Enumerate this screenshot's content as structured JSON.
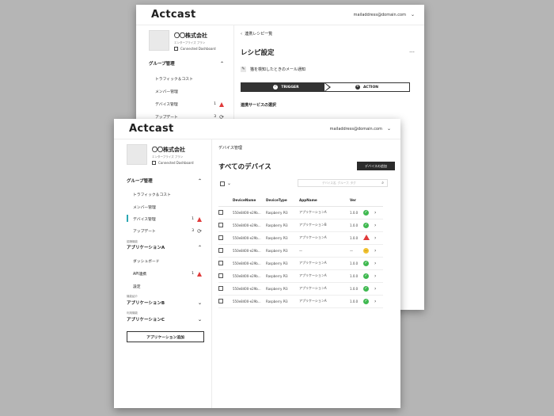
{
  "app": {
    "logo": "Actcast",
    "user_email": "mailaddress@domain.com"
  },
  "org": {
    "name": "〇〇株式会社",
    "plan": "エンタープライズ プラン",
    "dashboard_link": "Connected Dashboard"
  },
  "sidebar": {
    "group_header": "グループ管理",
    "group_items": [
      {
        "label": "トラフィック＆コスト"
      },
      {
        "label": "メンバー管理"
      },
      {
        "label": "デバイス管理",
        "count": "1"
      },
      {
        "label": "アップデート",
        "count": "3"
      }
    ],
    "apps": [
      {
        "sub": "認識機能",
        "name": "アプリケーションA",
        "items": [
          {
            "label": "ダッシュボード"
          },
          {
            "label": "API連携",
            "count": "1"
          },
          {
            "label": "設定"
          }
        ]
      },
      {
        "sub": "機能紹介",
        "name": "アプリケーションB"
      },
      {
        "sub": "利用機能",
        "name": "アプリケーションC"
      }
    ],
    "add_app_label": "アプリケーション追加"
  },
  "back": {
    "breadcrumb": "連携レシピ一覧",
    "title": "レシピ設定",
    "more": "…",
    "notify_label": "猫を検知したときのメール通知",
    "trigger_label": "TRIGGER",
    "action_label": "ACTION",
    "service_heading": "連携サービスの選択"
  },
  "front": {
    "breadcrumb": "デバイス管理",
    "title": "すべてのデバイス",
    "add_device_label": "デバイスの追加",
    "search_placeholder": "デバイス名, グループ, タグ",
    "columns": [
      "DeviceName",
      "DeviceType",
      "AppName",
      "Ver"
    ],
    "rows": [
      {
        "name": "550e8400-e29b...",
        "type": "Raspberry Pi3",
        "app": "アプリケーションA",
        "ver": "1.0.0",
        "status": "ok"
      },
      {
        "name": "550e8400-e29b...",
        "type": "Raspberry Pi3",
        "app": "アプリケーションB",
        "ver": "1.0.0",
        "status": "ok"
      },
      {
        "name": "550e8400-e29b...",
        "type": "Raspberry Pi3",
        "app": "アプリケーションA",
        "ver": "1.0.0",
        "status": "error"
      },
      {
        "name": "550e8400-e29b...",
        "type": "Raspberry Pi3",
        "app": "—",
        "ver": "—",
        "status": "warning"
      },
      {
        "name": "550e8400-e29b...",
        "type": "Raspberry Pi3",
        "app": "アプリケーションA",
        "ver": "1.0.0",
        "status": "ok"
      },
      {
        "name": "550e8400-e29b...",
        "type": "Raspberry Pi3",
        "app": "アプリケーションA",
        "ver": "1.0.0",
        "status": "ok"
      },
      {
        "name": "550e8400-e29b...",
        "type": "Raspberry Pi3",
        "app": "アプリケーションA",
        "ver": "1.0.0",
        "status": "ok"
      },
      {
        "name": "550e8400-e29b...",
        "type": "Raspberry Pi3",
        "app": "アプリケーションA",
        "ver": "1.0.0",
        "status": "ok"
      }
    ]
  },
  "colors": {
    "accent": "#2aa7b3",
    "ok": "#3fb950",
    "error": "#e03a3a",
    "warning": "#f2c230",
    "dark": "#2b2b2b"
  },
  "icons": {
    "chevron": "chevron-down-icon",
    "external": "external-link-icon",
    "search": "search-icon",
    "sync": "sync-icon",
    "alert": "alert-triangle-icon"
  }
}
